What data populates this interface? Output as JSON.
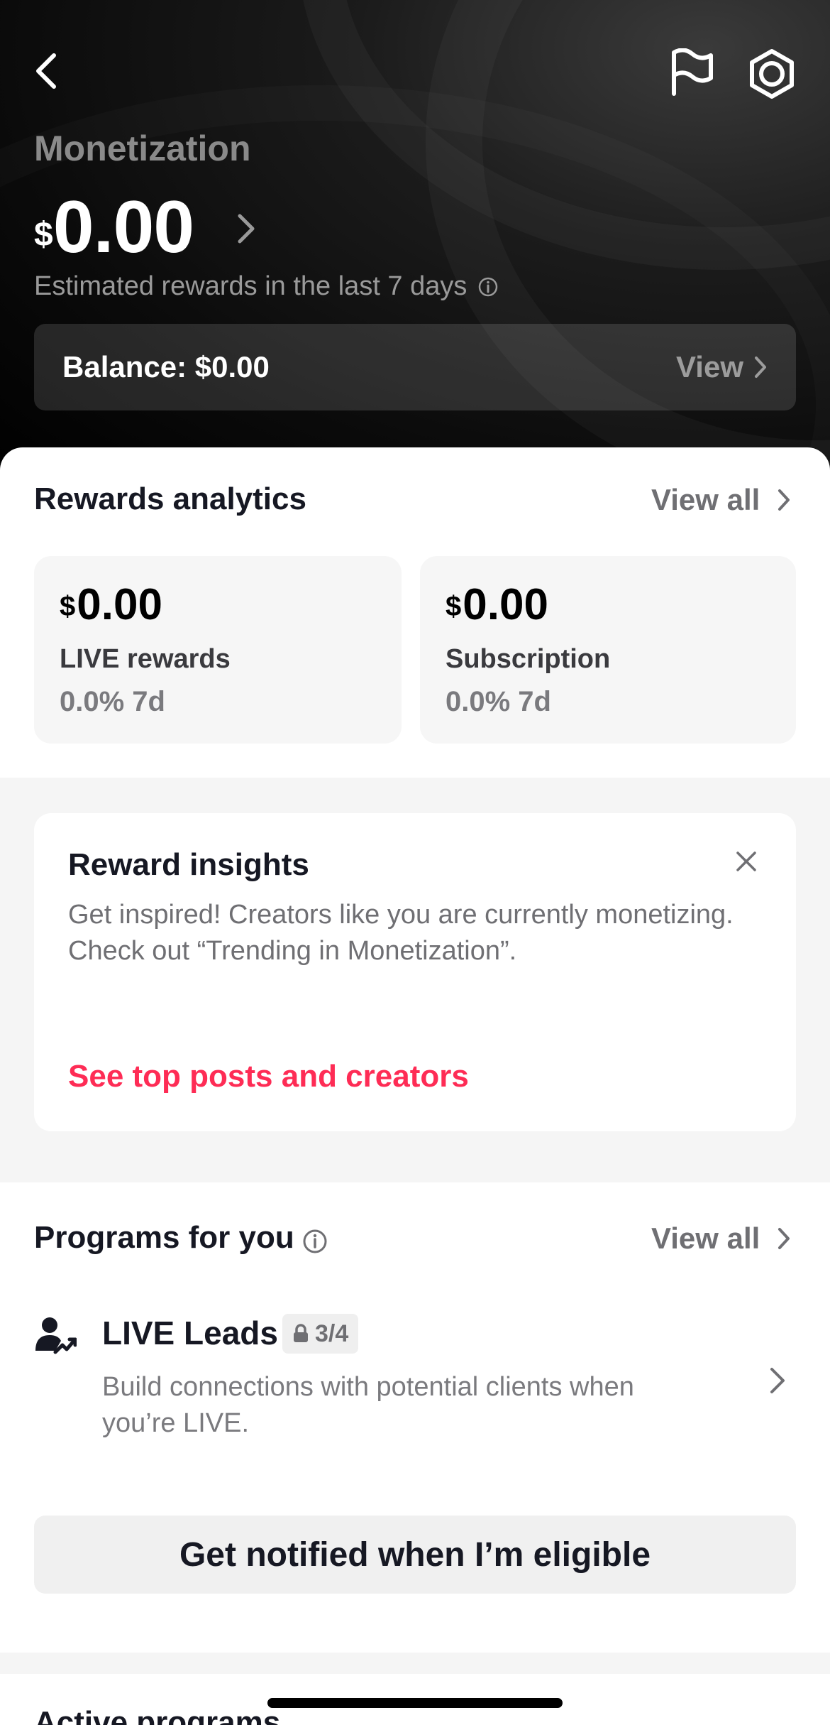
{
  "header": {
    "title": "Monetization",
    "currency_symbol": "$",
    "amount": "0.00",
    "estimate_label": "Estimated rewards in the last 7 days",
    "balance_label": "Balance: $0.00",
    "balance_view": "View",
    "icons": [
      "chevron-left-icon",
      "flag-icon",
      "gear-icon",
      "info-icon",
      "chevron-right-icon"
    ]
  },
  "rewards_analytics": {
    "title": "Rewards analytics",
    "view_all": "View all",
    "cards": [
      {
        "currency": "$",
        "amount": "0.00",
        "label": "LIVE rewards",
        "change": "0.0% 7d"
      },
      {
        "currency": "$",
        "amount": "0.00",
        "label": "Subscription",
        "change": "0.0% 7d"
      }
    ]
  },
  "insights": {
    "title": "Reward insights",
    "body": "Get inspired! Creators like you are currently monetizing. Check out “Trending in Monetization”.",
    "link": "See top posts and creators"
  },
  "programs": {
    "title": "Programs for you",
    "view_all": "View all",
    "items": [
      {
        "name": "LIVE Leads",
        "badge": "3/4",
        "description": "Build connections with potential clients when you’re LIVE."
      }
    ],
    "notify_button": "Get notified when I’m eligible"
  },
  "active_programs": {
    "title": "Active programs"
  },
  "colors": {
    "accent": "#fe2c55",
    "header_bg": "#000000",
    "card_bg": "#f6f6f6"
  }
}
